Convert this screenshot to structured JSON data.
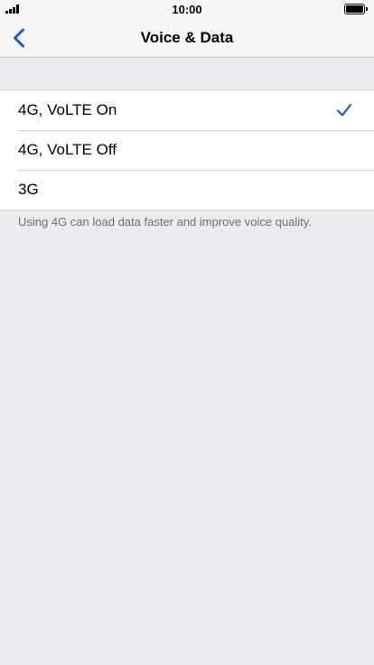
{
  "status_bar": {
    "time": "10:00",
    "signal_icon": "cellular-signal-icon",
    "battery_icon": "battery-full-icon"
  },
  "nav": {
    "title": "Voice & Data",
    "back_icon": "chevron-left-icon"
  },
  "options": [
    {
      "label": "4G, VoLTE On",
      "selected": true
    },
    {
      "label": "4G, VoLTE Off",
      "selected": false
    },
    {
      "label": "3G",
      "selected": false
    }
  ],
  "footnote": "Using 4G can load data faster and improve voice quality.",
  "colors": {
    "accent": "#1a5ad8",
    "background": "#ebebf0",
    "bar": "#f7f7f7",
    "secondary_text": "#6d6d72"
  }
}
